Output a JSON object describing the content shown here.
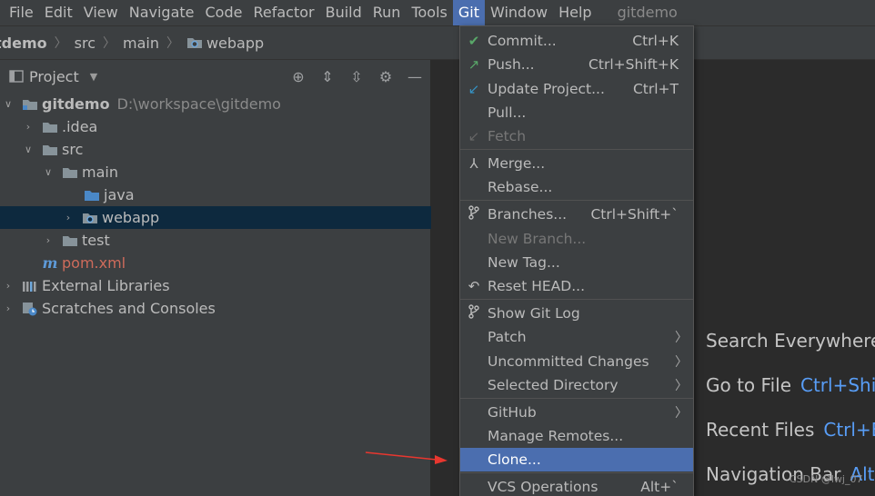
{
  "menubar": {
    "items": [
      "File",
      "Edit",
      "View",
      "Navigate",
      "Code",
      "Refactor",
      "Build",
      "Run",
      "Tools",
      "Git",
      "Window",
      "Help"
    ],
    "project_title": "gitdemo"
  },
  "breadcrumb": [
    "tdemo",
    "src",
    "main",
    "webapp"
  ],
  "project_panel": {
    "title": "Project",
    "tree": [
      {
        "label": "gitdemo",
        "path": "D:\\workspace\\gitdemo"
      },
      {
        "label": ".idea"
      },
      {
        "label": "src"
      },
      {
        "label": "main"
      },
      {
        "label": "java"
      },
      {
        "label": "webapp"
      },
      {
        "label": "test"
      },
      {
        "label": "pom.xml"
      },
      {
        "label": "External Libraries"
      },
      {
        "label": "Scratches and Consoles"
      }
    ]
  },
  "git_menu": {
    "items": [
      {
        "label": "Commit...",
        "shortcut": "Ctrl+K",
        "icon": "check-icon"
      },
      {
        "label": "Push...",
        "shortcut": "Ctrl+Shift+K",
        "icon": "push-arrow-icon"
      },
      {
        "label": "Update Project...",
        "shortcut": "Ctrl+T",
        "icon": "update-arrow-icon"
      },
      {
        "label": "Pull...",
        "shortcut": ""
      },
      {
        "label": "Fetch",
        "shortcut": "",
        "icon": "fetch-icon",
        "disabled": true
      },
      {
        "label": "Merge...",
        "shortcut": "",
        "icon": "merge-icon"
      },
      {
        "label": "Rebase...",
        "shortcut": ""
      },
      {
        "label": "Branches...",
        "shortcut": "Ctrl+Shift+`",
        "icon": "branch-icon"
      },
      {
        "label": "New Branch...",
        "shortcut": "",
        "disabled": true
      },
      {
        "label": "New Tag...",
        "shortcut": ""
      },
      {
        "label": "Reset HEAD...",
        "shortcut": "",
        "icon": "undo-icon"
      },
      {
        "label": "Show Git Log",
        "shortcut": "",
        "icon": "branch-icon"
      },
      {
        "label": "Patch",
        "submenu": true
      },
      {
        "label": "Uncommitted Changes",
        "submenu": true
      },
      {
        "label": "Selected Directory",
        "submenu": true
      },
      {
        "label": "GitHub",
        "submenu": true
      },
      {
        "label": "Manage Remotes...",
        "shortcut": ""
      },
      {
        "label": "Clone...",
        "shortcut": "",
        "highlighted": true
      },
      {
        "label": "VCS Operations",
        "shortcut": "Alt+`"
      }
    ]
  },
  "welcome_hints": [
    {
      "label": "Search Everywhere",
      "shortcut": ""
    },
    {
      "label": "Go to File",
      "shortcut": "Ctrl+Shif"
    },
    {
      "label": "Recent Files",
      "shortcut": "Ctrl+E"
    },
    {
      "label": "Navigation Bar",
      "shortcut": "Alt+"
    }
  ],
  "watermark": "CSDN @lwj_07",
  "colors": {
    "accent": "#4b6eaf",
    "selection": "#0d293e",
    "shortcut": "#589df6",
    "annotation_arrow": "#e8372f"
  }
}
